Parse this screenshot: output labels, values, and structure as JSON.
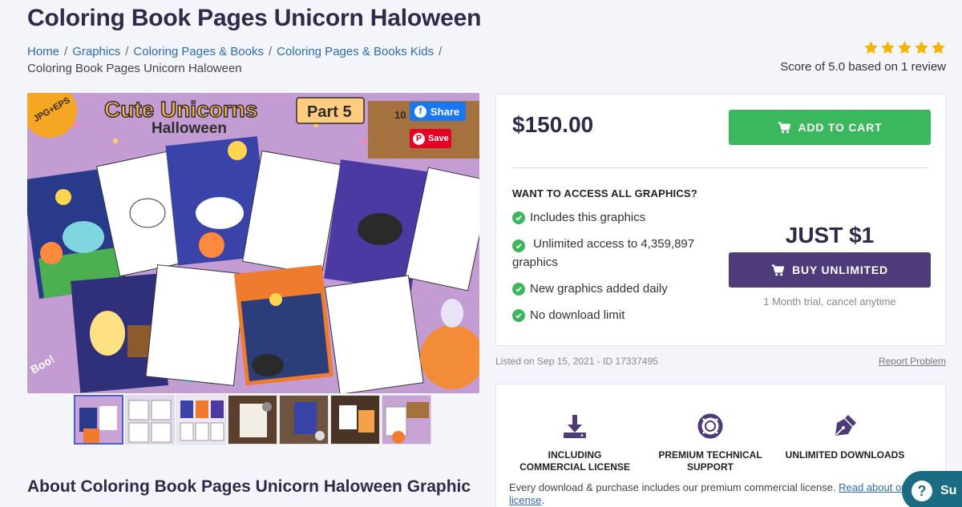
{
  "page": {
    "title": "Coloring Book Pages Unicorn Haloween"
  },
  "breadcrumb": {
    "items": [
      "Home",
      "Graphics",
      "Coloring Pages & Books",
      "Coloring Pages & Books Kids"
    ],
    "current": "Coloring Book Pages Unicorn Haloween"
  },
  "rating": {
    "stars": 5,
    "text": "Score of 5.0 based on 1 review"
  },
  "image": {
    "title_line1": "Cute Unicorns",
    "title_line2": "Halloween",
    "format_badge": "JPG+EPS",
    "part_badge": "Part 5",
    "sign_text": "10 10 illu",
    "boo_text": "Boo!"
  },
  "social": {
    "share_label": "Share",
    "save_label": "Save"
  },
  "about": {
    "heading": "About Coloring Book Pages Unicorn Haloween Graphic"
  },
  "purchase": {
    "price": "$150.00",
    "add_to_cart": "ADD TO CART",
    "access_title": "WANT TO ACCESS ALL GRAPHICS?",
    "features": [
      "Includes this graphics",
      "Unlimited access to 4,359,897 graphics",
      "New graphics added daily",
      "No download limit"
    ],
    "just_price": "JUST $1",
    "buy_unlimited": "BUY UNLIMITED",
    "trial_note": "1 Month trial, cancel anytime"
  },
  "listing": {
    "listed": "Listed on Sep 15, 2021 - ID 17337495",
    "report": "Report Problem"
  },
  "license": {
    "items": [
      {
        "label": "INCLUDING COMMERCIAL LICENSE",
        "icon": "download-icon"
      },
      {
        "label": "PREMIUM TECHNICAL SUPPORT",
        "icon": "lifebuoy-icon"
      },
      {
        "label": "UNLIMITED DOWNLOADS",
        "icon": "pen-nib-icon"
      }
    ],
    "note": "Every download & purchase includes our premium commercial license.",
    "link": "Read about our license"
  },
  "help": {
    "label": "Su"
  },
  "colors": {
    "green": "#3bb85d",
    "purple": "#4d3b7a",
    "link": "#2b6cb0",
    "title": "#2e2a4a"
  }
}
